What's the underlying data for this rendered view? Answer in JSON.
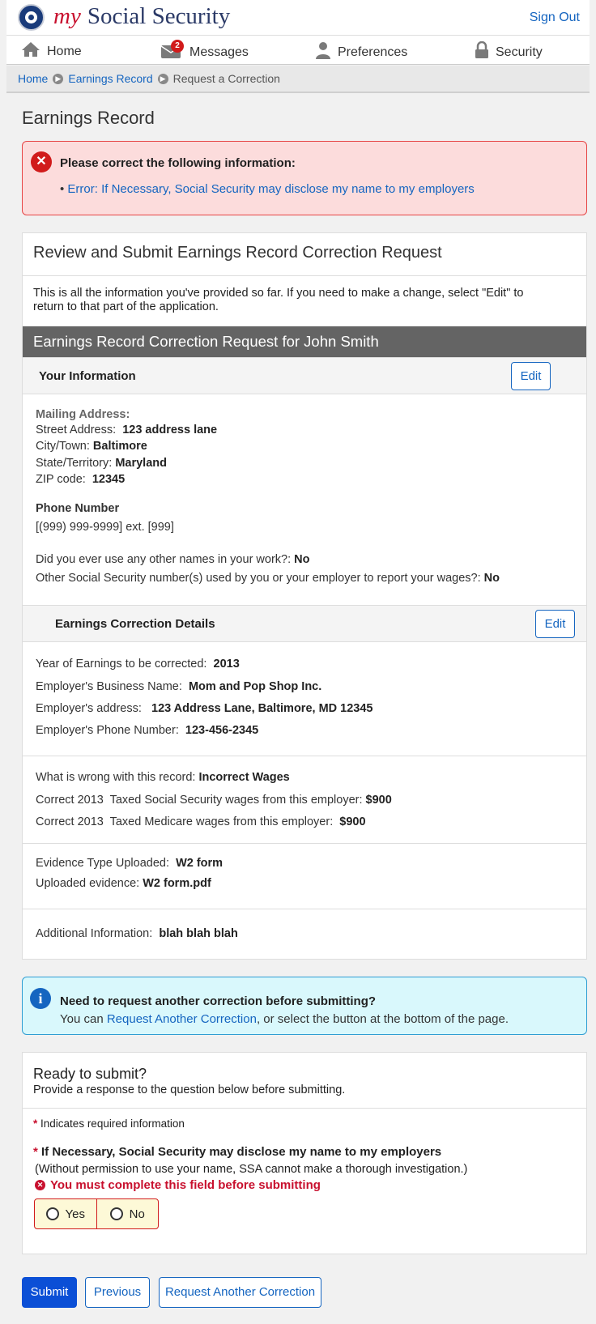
{
  "header": {
    "brand_my": "my",
    "brand_rest": "Social Security",
    "sign_out": "Sign Out"
  },
  "nav": {
    "home": "Home",
    "messages": "Messages",
    "messages_badge": "2",
    "preferences": "Preferences",
    "security": "Security"
  },
  "breadcrumb": {
    "home": "Home",
    "earnings": "Earnings Record",
    "current": "Request a Correction"
  },
  "page": {
    "title": "Earnings Record"
  },
  "error_box": {
    "title": "Please correct the following information:",
    "bullet": "• ",
    "item": "Error: If Necessary, Social Security may disclose my name to my employers"
  },
  "review": {
    "title": "Review and Submit Earnings Record Correction Request",
    "intro": "This is all the information you've provided so far. If you need to make a change, select \"Edit\" to return to that part of the application.",
    "bar_title": "Earnings Record Correction Request for John Smith",
    "edit_label": "Edit",
    "your_info": {
      "heading": "Your Information",
      "mailing_label": "Mailing Address:",
      "street_label": "Street Address:",
      "street": "123 address lane",
      "city_label": "City/Town:",
      "city": "Baltimore",
      "state_label": "State/Territory:",
      "state": "Maryland",
      "zip_label": "ZIP code:",
      "zip": "12345",
      "phone_label": "Phone Number",
      "phone": "[(999) 999-9999] ext. [999]",
      "other_names_label": "Did you ever use any other names in your work?:",
      "other_names": "No",
      "other_ssn_label": "Other Social Security number(s) used by you or your employer to report your wages?:",
      "other_ssn": "No"
    },
    "earnings": {
      "heading": "Earnings Correction Details",
      "year_label": "Year of Earnings to be corrected:",
      "year": "2013",
      "employer_label": "Employer's Business Name:",
      "employer": "Mom and Pop Shop Inc.",
      "address_label": "Employer's address:",
      "address": "123 Address Lane, Baltimore, MD 12345",
      "emp_phone_label": "Employer's Phone Number:",
      "emp_phone": "123-456-2345",
      "wrong_label": "What is wrong with this record:",
      "wrong": "Incorrect Wages",
      "ss_wages_label": "Correct 2013  Taxed Social Security wages from this employer:",
      "ss_wages": "$900",
      "med_wages_label": "Correct 2013  Taxed Medicare wages from this employer:",
      "med_wages": "$900",
      "evidence_label": "Evidence Type Uploaded:",
      "evidence": "W2 form",
      "uploaded_label": "Uploaded evidence:",
      "uploaded": "W2 form.pdf",
      "additional_label": "Additional Information:",
      "additional": "blah blah blah"
    }
  },
  "info_box": {
    "title": "Need to request another correction before submitting?",
    "text_before": "You can ",
    "link": "Request Another Correction",
    "text_after": ", or select the button at the bottom of the page."
  },
  "submit_section": {
    "title": "Ready to submit?",
    "subtitle": "Provide a response to the question below before submitting.",
    "required_note": "Indicates required information",
    "question": "If Necessary, Social Security may disclose my name to my employers",
    "help": "(Without permission to use your name, SSA cannot make a thorough investigation.)",
    "error": "You must complete this field before submitting",
    "options": [
      "Yes",
      "No"
    ]
  },
  "buttons": {
    "submit": "Submit",
    "previous": "Previous",
    "request_another": "Request Another Correction"
  }
}
